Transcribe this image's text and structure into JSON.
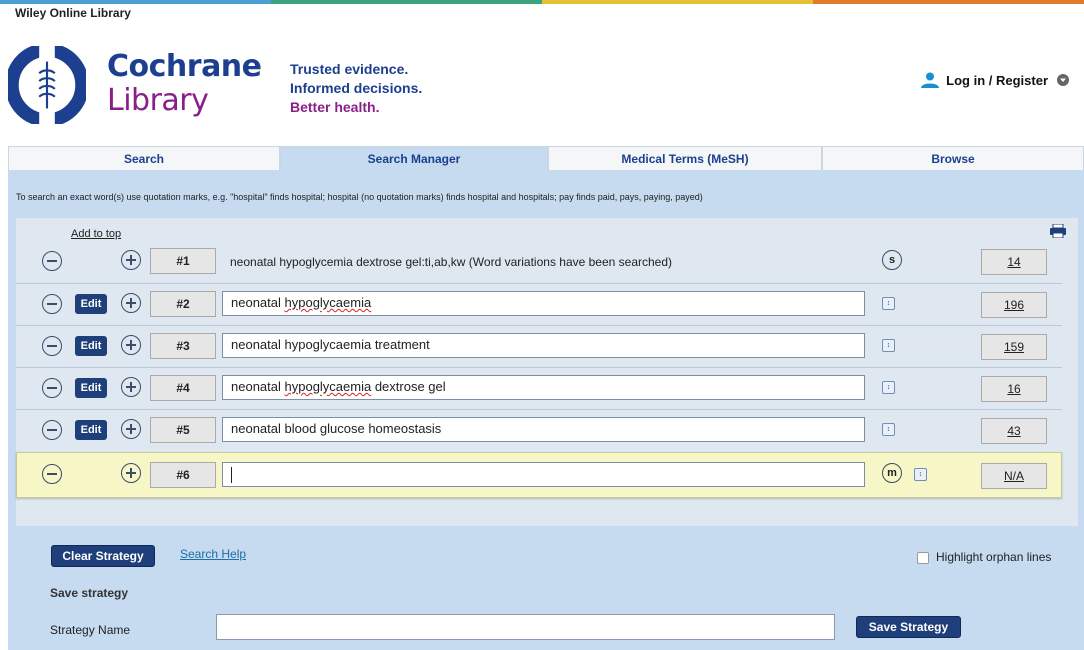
{
  "colors": {
    "topbar": [
      "#4a9fd5",
      "#3aa37f",
      "#e2c233",
      "#e07b2a"
    ],
    "brand_blue": "#1c3f8f",
    "brand_purple": "#8b1f8a",
    "panel": "#c6daf0",
    "highlight_row": "#f7f6c6"
  },
  "header": {
    "wiley": "Wiley Online Library",
    "brand_line1": "Cochrane",
    "brand_line2": "Library",
    "tagline1": "Trusted evidence.",
    "tagline2": "Informed decisions.",
    "tagline3": "Better health.",
    "login": "Log in / Register",
    "user_icon": "user-icon",
    "chevron_icon": "chevron-down-icon"
  },
  "tabs": [
    {
      "label": "Search",
      "active": false
    },
    {
      "label": "Search Manager",
      "active": true
    },
    {
      "label": "Medical Terms (MeSH)",
      "active": false
    },
    {
      "label": "Browse",
      "active": false
    }
  ],
  "hint": "To search an exact word(s) use quotation marks, e.g. \"hospital\" finds hospital; hospital (no quotation marks) finds hospital and hospitals; pay finds paid, pays, paying, payed)",
  "add_to_top": "Add to top",
  "rows": [
    {
      "num": "#1",
      "text": "neonatal hypoglycemia dextrose gel:ti,ab,kw (Word variations have been searched)",
      "count": "14",
      "badge": "s",
      "editable": false
    },
    {
      "num": "#2",
      "text": "neonatal hypoglycaemia",
      "count": "196",
      "edit_label": "Edit"
    },
    {
      "num": "#3",
      "text": "neonatal hypoglycaemia treatment",
      "count": "159",
      "edit_label": "Edit"
    },
    {
      "num": "#4",
      "text": "neonatal hypoglycaemia dextrose gel",
      "count": "16",
      "edit_label": "Edit"
    },
    {
      "num": "#5",
      "text": "neonatal blood glucose homeostasis",
      "count": "43",
      "edit_label": "Edit"
    },
    {
      "num": "#6",
      "text": "",
      "count": "N/A",
      "badge": "m"
    }
  ],
  "row_parts": {
    "r2": {
      "w1": "neonatal ",
      "w2": "hypoglycaemia"
    },
    "r4": {
      "w1": "neonatal ",
      "w2": "hypoglycaemia",
      "w3": " dextrose gel"
    }
  },
  "footer": {
    "clear_strategy": "Clear Strategy",
    "search_help": "Search Help",
    "highlight_orphan": "Highlight orphan lines",
    "save_strategy_heading": "Save strategy",
    "strategy_name_label": "Strategy Name",
    "strategy_name_value": "",
    "save_button": "Save Strategy"
  }
}
